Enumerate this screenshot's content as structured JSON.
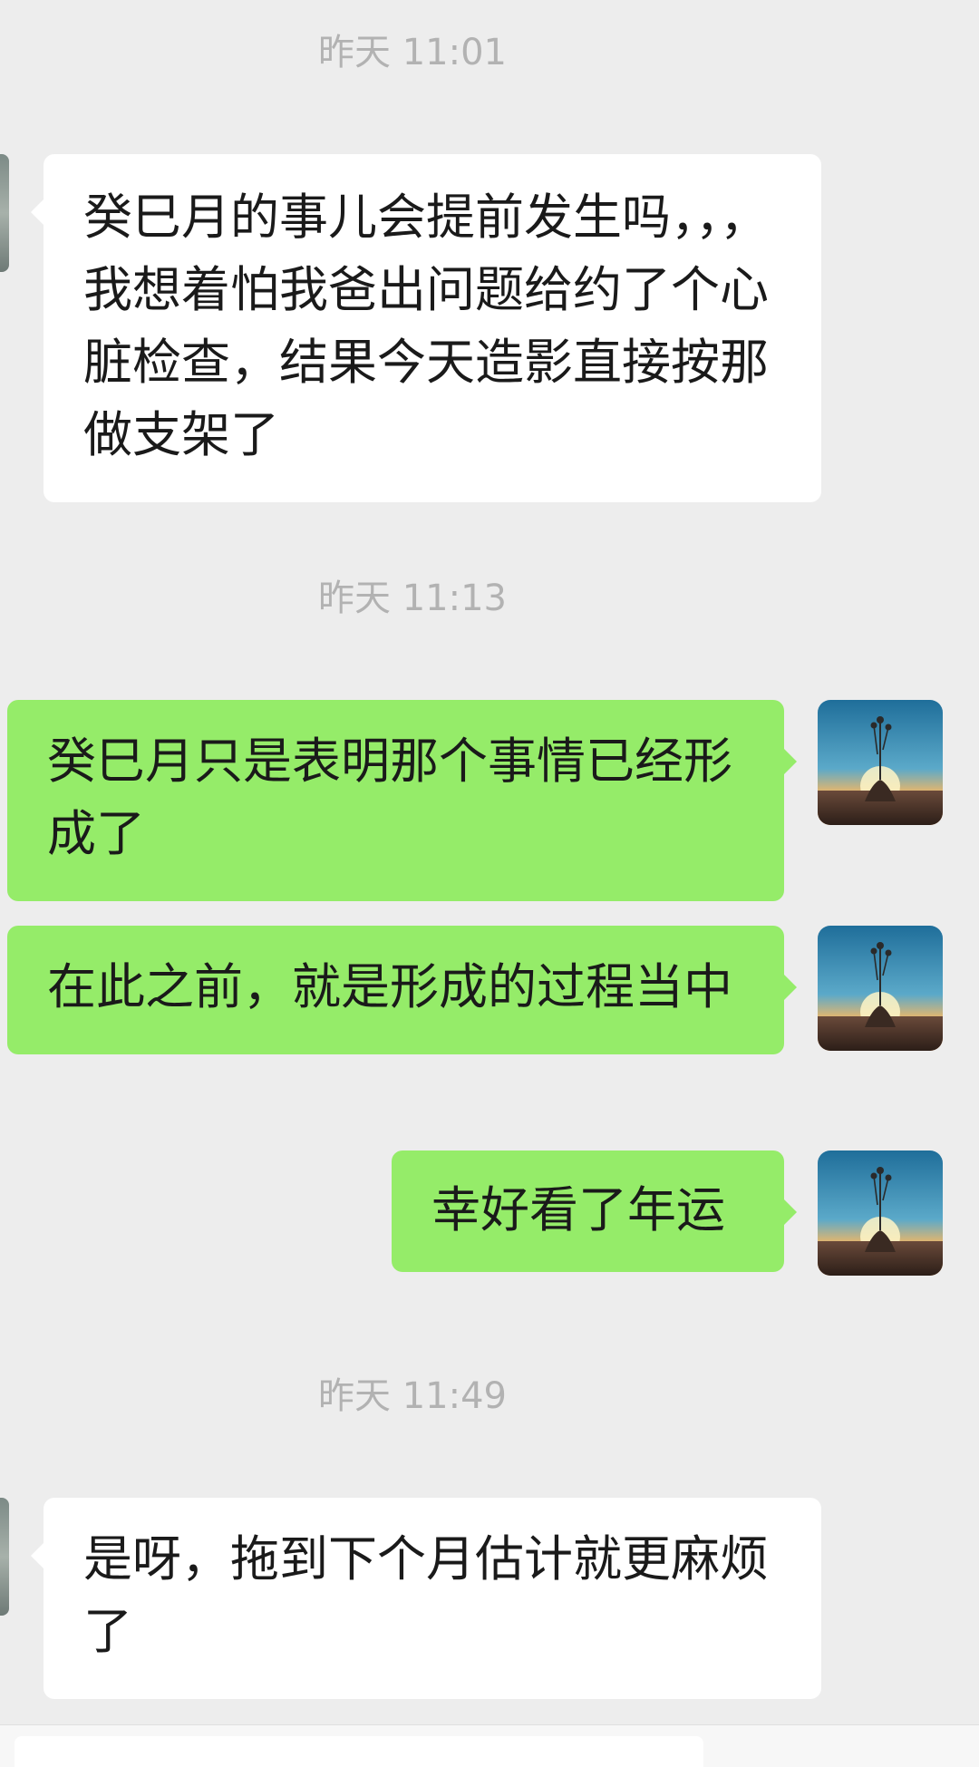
{
  "messages": [
    {
      "type": "timestamp",
      "text": "昨天 11:01"
    },
    {
      "type": "incoming",
      "text": "癸巳月的事儿会提前发生吗，，，我想着怕我爸出问题给约了个心脏检查，结果今天造影直接按那做支架了"
    },
    {
      "type": "timestamp",
      "text": "昨天 11:13"
    },
    {
      "type": "outgoing",
      "text": "癸巳月只是表明那个事情已经形成了"
    },
    {
      "type": "outgoing",
      "text": "在此之前，就是形成的过程当中"
    },
    {
      "type": "outgoing",
      "text": "幸好看了年运"
    },
    {
      "type": "timestamp",
      "text": "昨天 11:49"
    },
    {
      "type": "incoming",
      "text": "是呀，拖到下个月估计就更麻烦了"
    }
  ],
  "colors": {
    "background": "#ededed",
    "incoming_bubble": "#ffffff",
    "outgoing_bubble": "#95ec69",
    "timestamp_text": "#b2b2b2"
  },
  "icons": {
    "user_avatar": "avatar-sunset-hand-icon"
  }
}
